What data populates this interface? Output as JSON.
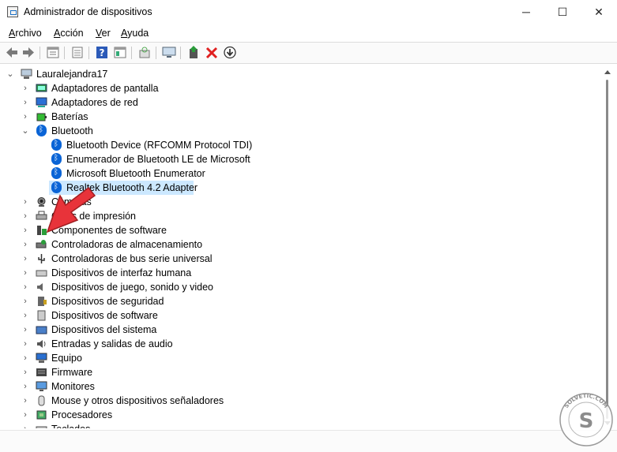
{
  "window": {
    "title": "Administrador de dispositivos",
    "controls": [
      "─",
      "☐",
      "✕"
    ]
  },
  "menu": [
    {
      "label": "Archivo",
      "underline": "A",
      "rest": "rchivo"
    },
    {
      "label": "Acción",
      "underline": "A",
      "rest": "cción"
    },
    {
      "label": "Ver",
      "underline": "V",
      "rest": "er"
    },
    {
      "label": "Ayuda",
      "underline": "A",
      "rest": "yuda"
    }
  ],
  "toolbar": {
    "buttons": [
      "back-icon",
      "forward-icon",
      "properties-icon",
      "device-list-icon",
      "help-icon",
      "view-icon",
      "scan-icon",
      "monitor-icon",
      "add-driver-icon",
      "uninstall-icon",
      "download-icon"
    ]
  },
  "tree": {
    "root": "Lauralejandra17",
    "categories": [
      {
        "label": "Adaptadores de pantalla",
        "icon": "display-adapter-icon",
        "expanded": false
      },
      {
        "label": "Adaptadores de red",
        "icon": "network-adapter-icon",
        "expanded": false
      },
      {
        "label": "Baterías",
        "icon": "battery-icon",
        "expanded": false
      },
      {
        "label": "Bluetooth",
        "icon": "bluetooth-icon",
        "expanded": true,
        "children": [
          {
            "label": "Bluetooth Device (RFCOMM Protocol TDI)",
            "selected": false
          },
          {
            "label": "Enumerador de Bluetooth LE de Microsoft",
            "selected": false
          },
          {
            "label": "Microsoft Bluetooth Enumerator",
            "selected": false
          },
          {
            "label": "Realtek Bluetooth 4.2 Adapter",
            "selected": true
          }
        ]
      },
      {
        "label": "Cámaras",
        "icon": "camera-icon",
        "expanded": false
      },
      {
        "label": "Colas de impresión",
        "icon": "printer-icon",
        "expanded": false
      },
      {
        "label": "Componentes de software",
        "icon": "software-component-icon",
        "expanded": false
      },
      {
        "label": "Controladoras de almacenamiento",
        "icon": "storage-controller-icon",
        "expanded": false
      },
      {
        "label": "Controladoras de bus serie universal",
        "icon": "usb-icon",
        "expanded": false
      },
      {
        "label": "Dispositivos de interfaz humana",
        "icon": "hid-icon",
        "expanded": false
      },
      {
        "label": "Dispositivos de juego, sonido y video",
        "icon": "sound-icon",
        "expanded": false
      },
      {
        "label": "Dispositivos de seguridad",
        "icon": "security-device-icon",
        "expanded": false
      },
      {
        "label": "Dispositivos de software",
        "icon": "software-device-icon",
        "expanded": false
      },
      {
        "label": "Dispositivos del sistema",
        "icon": "system-device-icon",
        "expanded": false
      },
      {
        "label": "Entradas y salidas de audio",
        "icon": "audio-io-icon",
        "expanded": false
      },
      {
        "label": "Equipo",
        "icon": "computer-icon",
        "expanded": false
      },
      {
        "label": "Firmware",
        "icon": "firmware-icon",
        "expanded": false
      },
      {
        "label": "Monitores",
        "icon": "monitor-icon",
        "expanded": false
      },
      {
        "label": "Mouse y otros dispositivos señaladores",
        "icon": "mouse-icon",
        "expanded": false
      },
      {
        "label": "Procesadores",
        "icon": "processor-icon",
        "expanded": false
      },
      {
        "label": "Teclados",
        "icon": "keyboard-icon",
        "expanded": false
      }
    ]
  },
  "colors": {
    "selection": "#cce8ff",
    "bluetooth": "#0a64d6",
    "uninstall": "#e02020",
    "pointer_arrow": "#e8333a"
  },
  "watermark": "SOLVETIC.COM"
}
